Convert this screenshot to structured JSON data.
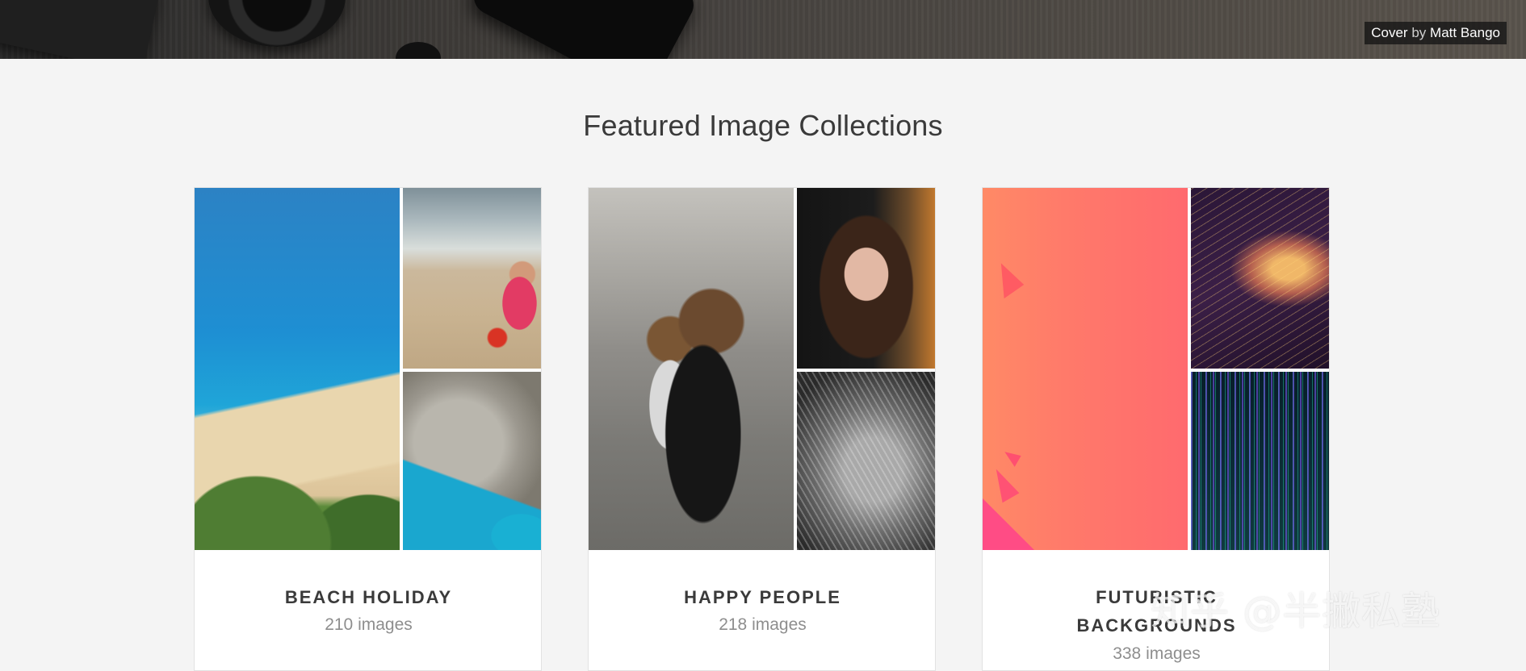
{
  "hero": {
    "credit_prefix": "Cover",
    "credit_by": "by",
    "credit_name": "Matt Bango"
  },
  "section": {
    "title": "Featured Image Collections"
  },
  "collections": [
    {
      "title": "BEACH HOLIDAY",
      "count": "210 images"
    },
    {
      "title": "HAPPY PEOPLE",
      "count": "218 images"
    },
    {
      "title_line1": "FUTURISTIC",
      "title_line2": "BACKGROUNDS",
      "count": "338 images"
    }
  ],
  "watermark": "知乎 @半撇私塾",
  "colors": {
    "page_bg": "#f4f4f4",
    "title_text": "#3a3a3a",
    "count_text": "#8e8e8e",
    "card_bg": "#ffffff"
  }
}
